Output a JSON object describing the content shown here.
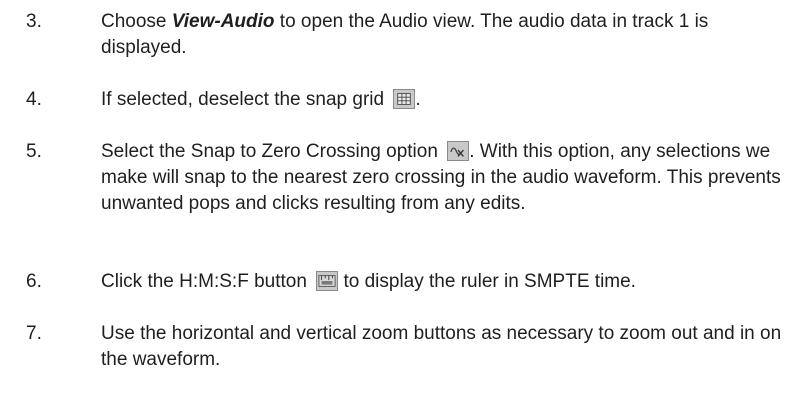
{
  "steps": [
    {
      "number": "3.",
      "before": "Choose ",
      "emphasis": "View-Audio",
      "after": " to open the Audio view. The audio data in track 1 is displayed."
    },
    {
      "number": "4.",
      "before": "If selected, deselect the snap grid ",
      "icon": "snap-grid-icon",
      "after": "."
    },
    {
      "number": "5.",
      "before": "Select the Snap to Zero Crossing option ",
      "icon": "zero-crossing-icon",
      "after": ". With this option, any selections we make will snap to the nearest zero crossing in the audio waveform. This prevents unwanted pops and clicks resulting from any edits."
    },
    {
      "number": "6.",
      "before": "Click the H:M:S:F button ",
      "icon": "hmsf-ruler-icon",
      "after": " to display the ruler in SMPTE time."
    },
    {
      "number": "7.",
      "before": "Use the horizontal and vertical zoom buttons as necessary to zoom out and in on the waveform."
    }
  ]
}
